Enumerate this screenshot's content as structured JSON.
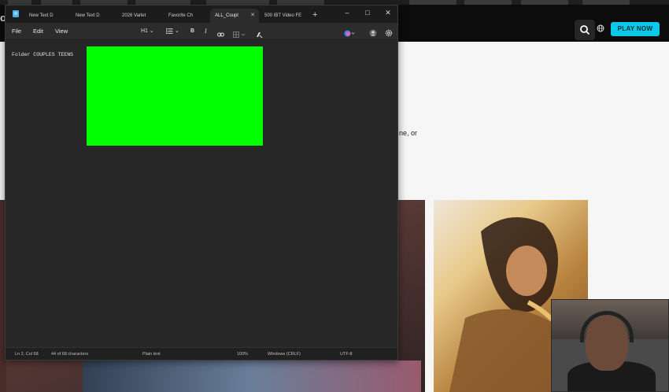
{
  "site": {
    "logo_text": "on",
    "play_button": "PLAY NOW",
    "body_snippet": "ne, or"
  },
  "notepad": {
    "tabs": [
      {
        "label": "New Text D",
        "active": false
      },
      {
        "label": "New Text D",
        "active": false
      },
      {
        "label": "2026 Varlet",
        "active": false
      },
      {
        "label": "Favorite Ch",
        "active": false
      },
      {
        "label": "ALL_Coupl",
        "active": true
      },
      {
        "label": "500 IBT Video FE",
        "active": false
      }
    ],
    "tab_close_glyph": "✕",
    "new_tab_glyph": "+",
    "window_controls": {
      "minimize": "–",
      "maximize": "□",
      "close": "✕"
    },
    "menu": {
      "file": "File",
      "edit": "Edit",
      "view": "View"
    },
    "toolbar": {
      "heading": "H1",
      "list_icon": "list-icon",
      "bold": "B",
      "italic": "I",
      "link_icon": "link-icon",
      "table_icon": "table-icon",
      "clear_format_icon": "clear-format-icon",
      "copilot_icon": "copilot-icon",
      "account_icon": "account-icon",
      "settings_icon": "gear-icon"
    },
    "editor_text": "Folder COUPLES TEENS",
    "status": {
      "position": "Ln 2, Col 68",
      "characters": "44 of 68 characters",
      "format": "Plain text",
      "zoom": "100%",
      "line_ending": "Windows (CRLF)",
      "encoding": "UTF-8"
    }
  },
  "colors": {
    "accent_green": "#00ff00",
    "play_button": "#0ac8e8",
    "editor_bg": "#272727"
  }
}
